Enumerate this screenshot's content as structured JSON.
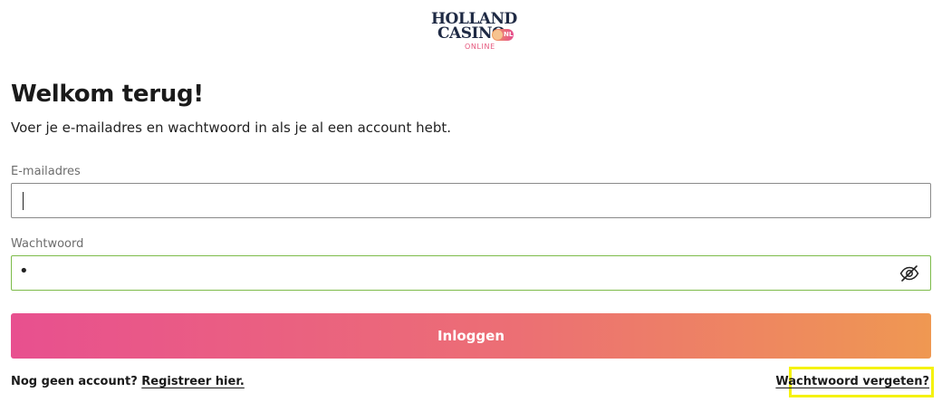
{
  "logo": {
    "line1": "HOLLAND",
    "line2": "CASINO",
    "badge": "NL",
    "sub": "ONLINE"
  },
  "heading": {
    "title": "Welkom terug!",
    "subtitle": "Voer je e-mailadres en wachtwoord in als je al een account hebt."
  },
  "form": {
    "email_label": "E-mailadres",
    "email_value": "",
    "password_label": "Wachtwoord",
    "password_value": "•",
    "password_toggle_icon": "eye-slash-icon",
    "login_label": "Inloggen"
  },
  "footer": {
    "no_account_text": "Nog geen account?",
    "register_link": "Registreer hier.",
    "forgot_link": "Wachtwoord vergeten?"
  },
  "colors": {
    "button_gradient_start": "#e8508f",
    "button_gradient_end": "#ef9852",
    "password_border": "#7dbb4a",
    "highlight": "#f5f20c"
  }
}
